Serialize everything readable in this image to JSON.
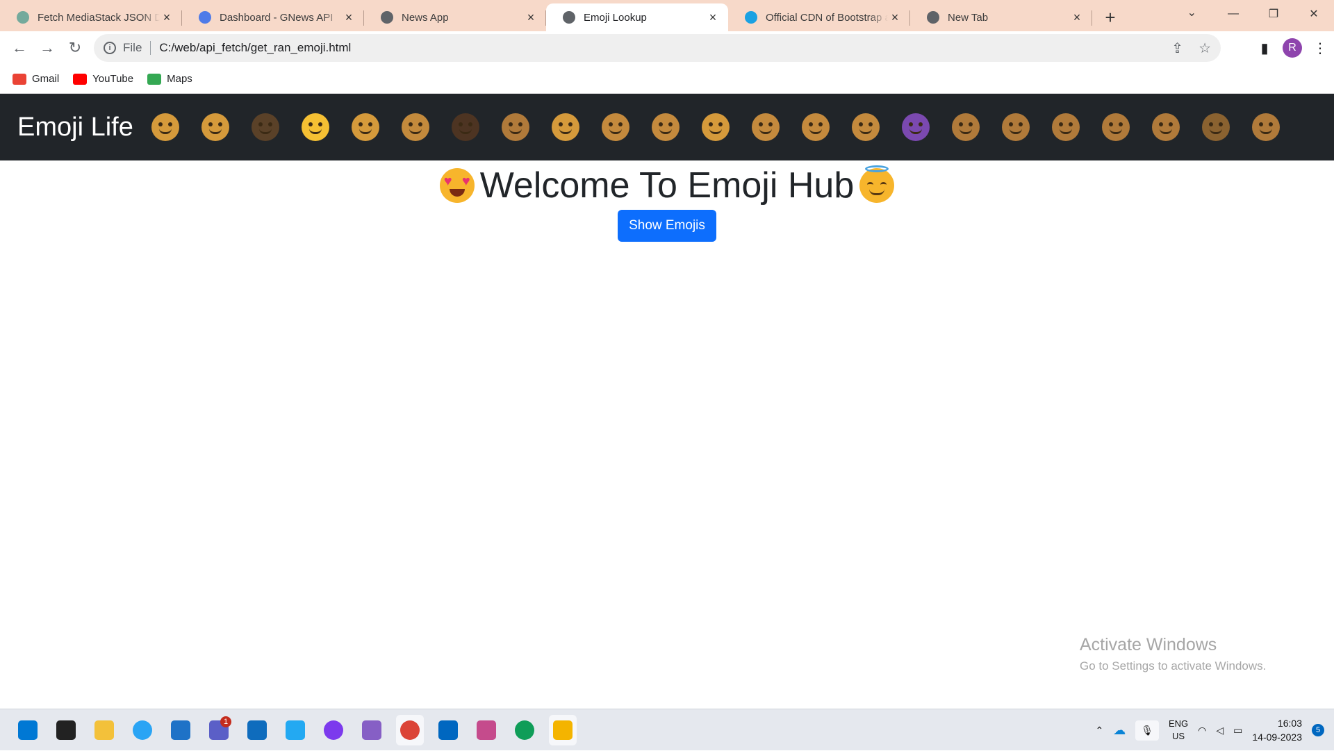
{
  "browser": {
    "tabs": [
      {
        "title": "Fetch MediaStack JSON Dat",
        "favicon_color": "#74aa9c",
        "active": false
      },
      {
        "title": "Dashboard - GNews API",
        "favicon_color": "#4f7be8",
        "active": false
      },
      {
        "title": "News App",
        "favicon_color": "#5f6368",
        "active": false
      },
      {
        "title": "Emoji Lookup",
        "favicon_color": "#5f6368",
        "active": true
      },
      {
        "title": "Official CDN of Bootstrap a",
        "favicon_color": "#1ba1e2",
        "active": false
      },
      {
        "title": "New Tab",
        "favicon_color": "#5f6368",
        "active": false
      }
    ],
    "address": {
      "scheme_label": "File",
      "url": "C:/web/api_fetch/get_ran_emoji.html"
    },
    "profile_initial": "R",
    "bookmarks": [
      {
        "label": "Gmail",
        "icon": "gmail-icon",
        "color": "#ea4335"
      },
      {
        "label": "YouTube",
        "icon": "youtube-icon",
        "color": "#ff0000"
      },
      {
        "label": "Maps",
        "icon": "maps-icon",
        "color": "#34a853"
      }
    ]
  },
  "page": {
    "brand": "Emoji Life",
    "navbar_emojis": [
      {
        "name": "smiling-face-icon",
        "color": "#d59a3b"
      },
      {
        "name": "face-savoring-food-icon",
        "color": "#d59a3b"
      },
      {
        "name": "relieved-face-icon",
        "color": "#5a4128"
      },
      {
        "name": "smiling-face-with-halo-icon",
        "color": "#f5c033"
      },
      {
        "name": "smiling-face-with-heart-eyes-icon",
        "color": "#d59a3b"
      },
      {
        "name": "smiling-face-with-sunglasses-icon",
        "color": "#c38a3c"
      },
      {
        "name": "face-blowing-kiss-icon",
        "color": "#4d3422"
      },
      {
        "name": "grinning-face-icon",
        "color": "#b07a3a"
      },
      {
        "name": "beaming-face-icon",
        "color": "#d59a3b"
      },
      {
        "name": "face-with-tears-of-joy-icon",
        "color": "#c48a3d"
      },
      {
        "name": "grinning-face-big-eyes-icon",
        "color": "#c48a3d"
      },
      {
        "name": "grinning-face-smiling-eyes-icon",
        "color": "#d59a3b"
      },
      {
        "name": "grinning-face-with-sweat-icon",
        "color": "#c48a3d"
      },
      {
        "name": "grinning-squinting-face-icon",
        "color": "#c48a3d"
      },
      {
        "name": "smiling-face-with-halo-icon-2",
        "color": "#c48a3d"
      },
      {
        "name": "smiling-face-with-horns-icon",
        "color": "#7b49b0"
      },
      {
        "name": "winking-face-icon",
        "color": "#b07a3a"
      },
      {
        "name": "smiling-face-icon-2",
        "color": "#b07a3a"
      },
      {
        "name": "face-savoring-food-icon-2",
        "color": "#b07a3a"
      },
      {
        "name": "relieved-face-icon-2",
        "color": "#b07a3a"
      },
      {
        "name": "smiling-face-with-heart-eyes-icon-2",
        "color": "#b07a3a"
      },
      {
        "name": "smiling-face-with-sunglasses-icon-2",
        "color": "#8a6230"
      },
      {
        "name": "face-with-rolling-eyes-icon",
        "color": "#b07a3a"
      }
    ],
    "headline": "Welcome To Emoji Hub",
    "button_label": "Show Emojis",
    "watermark": {
      "line1": "Activate Windows",
      "line2": "Go to Settings to activate Windows."
    }
  },
  "taskbar": {
    "apps": [
      {
        "name": "start-button",
        "color": "#0078d4"
      },
      {
        "name": "search-button",
        "color": "#222222"
      },
      {
        "name": "file-explorer-icon",
        "color": "#f3c13a"
      },
      {
        "name": "edge-icon",
        "color": "#2aa4f4"
      },
      {
        "name": "microsoft-store-icon",
        "color": "#1e72c7"
      },
      {
        "name": "teams-icon",
        "color": "#5b5fc7",
        "badge": "1"
      },
      {
        "name": "outlook-icon",
        "color": "#0f6cbd"
      },
      {
        "name": "vscode-icon",
        "color": "#23a9f2"
      },
      {
        "name": "github-desktop-icon",
        "color": "#7c3aed"
      },
      {
        "name": "visual-studio-icon",
        "color": "#865fc5"
      },
      {
        "name": "chrome-profile-icon",
        "color": "#db4437"
      },
      {
        "name": "mail-icon",
        "color": "#0067c0"
      },
      {
        "name": "snipping-tool-icon",
        "color": "#c54b8c"
      },
      {
        "name": "chrome-icon",
        "color": "#0f9d58"
      },
      {
        "name": "file-manager-icon",
        "color": "#f4b400"
      }
    ],
    "tray": {
      "lang_top": "ENG",
      "lang_bottom": "US",
      "time": "16:03",
      "date": "14-09-2023",
      "notification_count": "5"
    }
  }
}
